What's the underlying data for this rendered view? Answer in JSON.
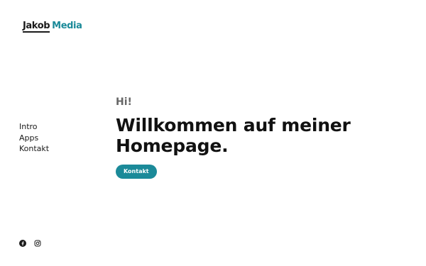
{
  "logo": {
    "part1": "Jakob",
    "part2": "Media",
    "accent_color": "#1b8a99"
  },
  "nav": {
    "items": [
      {
        "label": "Intro"
      },
      {
        "label": "Apps"
      },
      {
        "label": "Kontakt"
      }
    ]
  },
  "hero": {
    "greeting": "Hi!",
    "headline": "Willkommen auf meiner Homepage.",
    "cta_label": "Kontakt",
    "cta_color": "#1b8a99"
  },
  "social": {
    "icons": [
      "facebook-icon",
      "instagram-icon"
    ]
  }
}
